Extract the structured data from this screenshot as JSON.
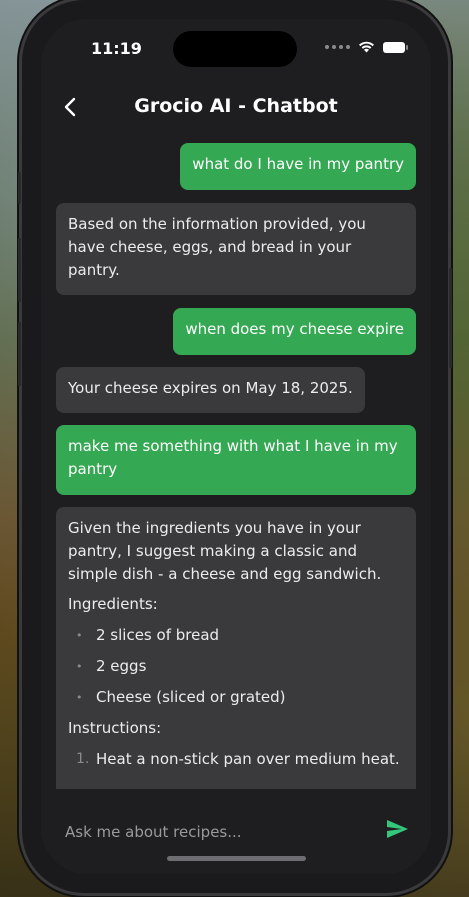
{
  "status_bar": {
    "time": "11:19"
  },
  "header": {
    "title": "Grocio AI - Chatbot"
  },
  "messages": [
    {
      "role": "user",
      "text": "what do I have in my pantry"
    },
    {
      "role": "bot",
      "text": "Based on the information provided, you have cheese, eggs, and bread in your pantry."
    },
    {
      "role": "user",
      "text": "when does my cheese expire"
    },
    {
      "role": "bot",
      "text": "Your cheese expires on May 18, 2025."
    },
    {
      "role": "user",
      "text": "make me something with what I have in my pantry"
    },
    {
      "role": "bot",
      "intro": "Given the ingredients you have in your pantry, I suggest making a classic and simple dish - a cheese and egg sandwich.",
      "ingredients_heading": "Ingredients:",
      "ingredients": [
        "2 slices of bread",
        "2 eggs",
        "Cheese (sliced or grated)"
      ],
      "instructions_heading": "Instructions:",
      "instructions": [
        "Heat a non-stick pan over medium heat."
      ]
    }
  ],
  "input": {
    "placeholder": "Ask me about recipes..."
  },
  "colors": {
    "user_bubble": "#34a853",
    "bot_bubble": "#3a3a3c",
    "send_icon": "#34c77b"
  }
}
